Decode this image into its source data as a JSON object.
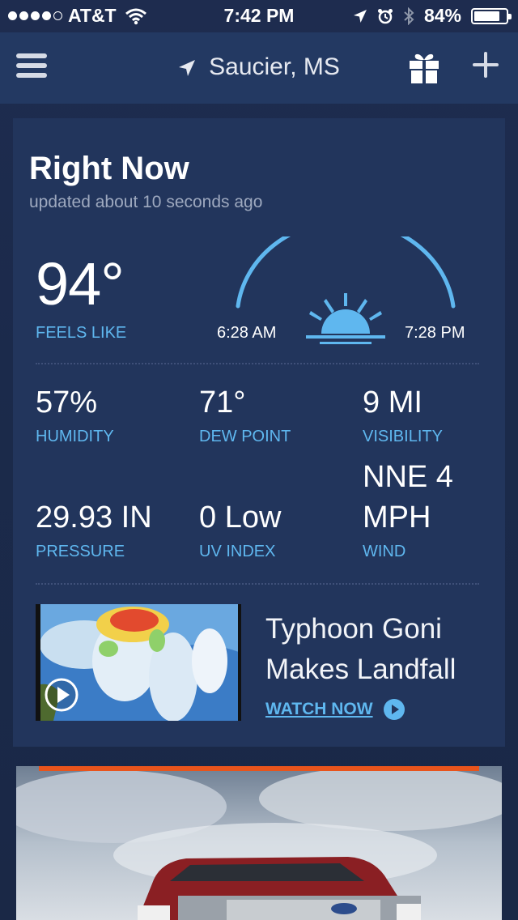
{
  "status_bar": {
    "carrier": "AT&T",
    "time": "7:42 PM",
    "battery": "84%",
    "battery_level": 0.84
  },
  "nav": {
    "location": "Saucier, MS"
  },
  "right_now": {
    "title": "Right Now",
    "updated": "updated about 10 seconds ago",
    "temperature": "94°",
    "feels_like_label": "FEELS LIKE",
    "sunrise": "6:28 AM",
    "sunset": "7:28 PM",
    "stats": [
      {
        "value": "57%",
        "label": "HUMIDITY"
      },
      {
        "value": "71°",
        "label": "DEW POINT"
      },
      {
        "value": "9 MI",
        "label": "VISIBILITY"
      },
      {
        "value": "29.93 IN",
        "label": "PRESSURE"
      },
      {
        "value": "0 Low",
        "label": "UV INDEX"
      },
      {
        "value_line1": "NNE 4",
        "value_line2": "MPH",
        "label": "WIND"
      }
    ]
  },
  "video": {
    "title_line1": "Typhoon Goni",
    "title_line2": "Makes Landfall",
    "cta": "WATCH NOW"
  },
  "colors": {
    "accent": "#5fb7ef",
    "navbar": "#233962",
    "card": "#22355c",
    "ad_stripe": "#e8541c"
  }
}
